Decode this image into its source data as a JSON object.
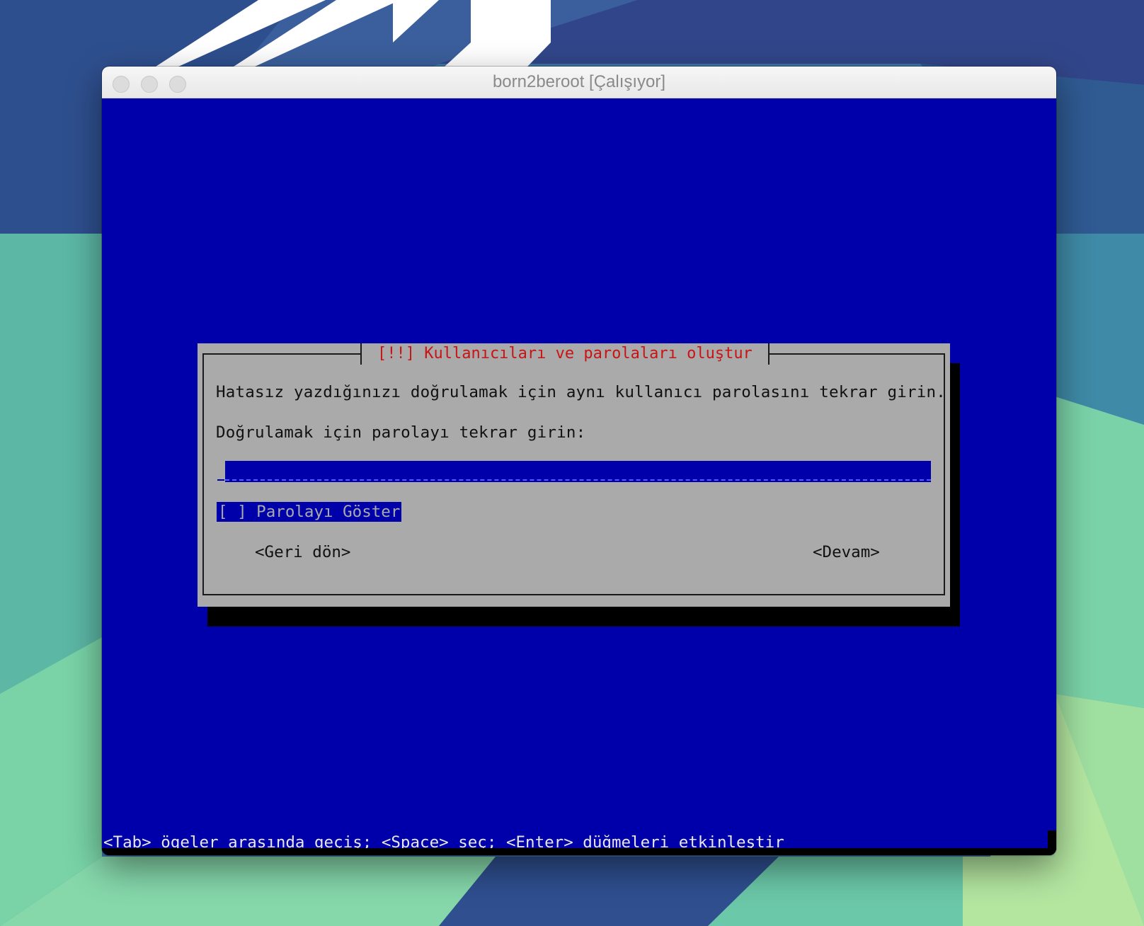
{
  "window": {
    "title": "born2beroot [Çalışıyor]"
  },
  "installer": {
    "dialog_title": "[!!] Kullanıcıları ve parolaları oluştur",
    "description": "Hatasız yazdığınızı doğrulamak için aynı kullanıcı parolasını tekrar girin.",
    "prompt_label": "Doğrulamak için parolayı tekrar girin:",
    "password_value": "",
    "show_password_checkbox": "[ ] Parolayı Göster",
    "back_button": "<Geri dön>",
    "continue_button": "<Devam>",
    "help_text": "<Tab> ögeler arasında geçiş; <Space> seç; <Enter> düğmeleri etkinleştir"
  },
  "colors": {
    "screen_blue": "#0000aa",
    "dialog_gray": "#aaaaaa",
    "title_red": "#c81414",
    "shadow_black": "#000000"
  }
}
